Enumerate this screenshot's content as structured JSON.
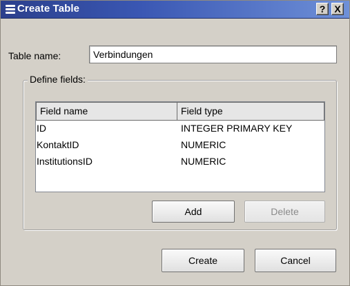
{
  "window": {
    "title": "Create Table",
    "help_button": "?",
    "close_button": "X"
  },
  "table_name": {
    "label": "Table name:",
    "value": "Verbindungen"
  },
  "fields_group": {
    "label": "Define fields:",
    "columns": [
      "Field name",
      "Field type"
    ],
    "rows": [
      {
        "name": "ID",
        "type": "INTEGER PRIMARY KEY"
      },
      {
        "name": "KontaktID",
        "type": "NUMERIC"
      },
      {
        "name": "InstitutionsID",
        "type": "NUMERIC"
      }
    ],
    "add_label": "Add",
    "delete_label": "Delete"
  },
  "footer": {
    "create_label": "Create",
    "cancel_label": "Cancel"
  }
}
